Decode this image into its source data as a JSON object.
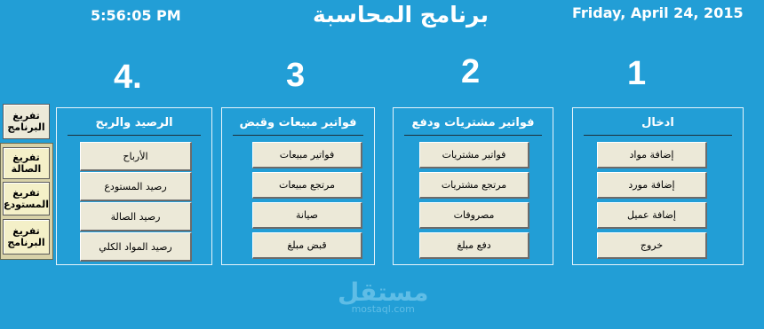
{
  "header": {
    "time": "5:56:05 PM",
    "title": "برنامج المحاسبة",
    "date": "Friday, April 24, 2015"
  },
  "sections": [
    {
      "number": "1",
      "title": "ادخال",
      "buttons": [
        "إضافة مواد",
        "إضافة مورد",
        "إضافة عميل",
        "خروج"
      ]
    },
    {
      "number": "2",
      "title": "فواتير مشتريات ودفع",
      "buttons": [
        "فواتير مشتريات",
        "مرتجع مشتريات",
        "مصروفات",
        "دفع مبلغ"
      ]
    },
    {
      "number": "3",
      "title": "فواتير مبيعات وقبض",
      "buttons": [
        "فواتير مبيعات",
        "مرتجع مبيعات",
        "صيانة",
        "قبض مبلغ"
      ]
    },
    {
      "number": "4.",
      "title": "الرصيد والربح",
      "buttons": [
        "الأرباح",
        "رصيد المستودع",
        "رصيد الصالة",
        "رصيد المواد الكلي"
      ]
    }
  ],
  "side_buttons": {
    "top": "تفريغ\nالبرنامج",
    "group": [
      "تفريغ\nالصالة",
      "تفريغ\nالمستودع",
      "تفريغ\nالبرنامج"
    ]
  },
  "watermark": {
    "arabic": "مستقل",
    "latin": "mostaql.com"
  }
}
